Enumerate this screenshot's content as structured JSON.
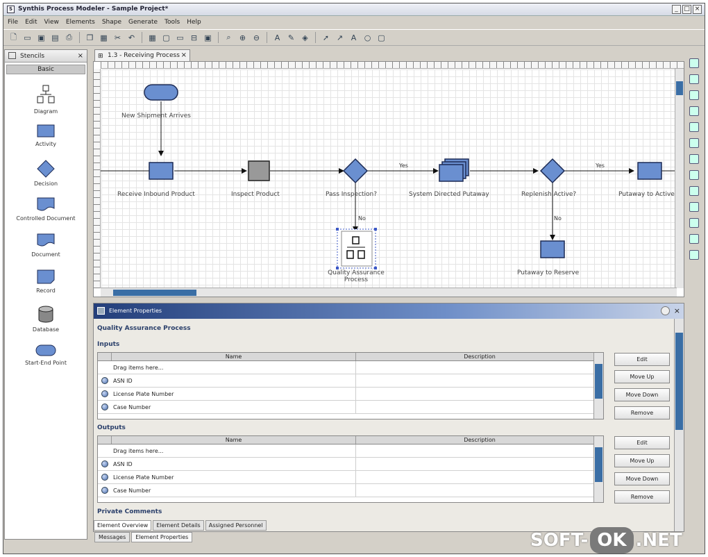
{
  "window": {
    "title": "Synthis Process Modeler - Sample Project*",
    "buttons": [
      "_",
      "□",
      "×"
    ]
  },
  "menu": [
    "File",
    "Edit",
    "View",
    "Elements",
    "Shape",
    "Generate",
    "Tools",
    "Help"
  ],
  "toolbar_icons": [
    "new-icon",
    "open-icon",
    "save-icon",
    "save-all-icon",
    "print-icon",
    "print-preview-icon",
    "copy-icon",
    "paste-icon",
    "cut-icon",
    "undo-icon",
    "grid-icon",
    "layout-icon",
    "align-icon",
    "distribute-icon",
    "page-icon",
    "zoom-fit-icon",
    "zoom-in-icon",
    "zoom-out-icon",
    "text-color-icon",
    "line-color-icon",
    "fill-color-icon",
    "pointer-icon",
    "connector-icon",
    "text-tool-icon",
    "ellipse-tool-icon",
    "rectangle-tool-icon"
  ],
  "stencils": {
    "title": "Stencils",
    "close": "×",
    "group": "Basic",
    "items": [
      "Diagram",
      "Activity",
      "Decision",
      "Controlled Document",
      "Document",
      "Record",
      "Database",
      "Start-End Point"
    ]
  },
  "diagram_tab": {
    "label": "1.3 - Receiving Process",
    "close": "×"
  },
  "diagram": {
    "nodes": {
      "start": "New Shipment Arrives",
      "receive": "Receive Inbound Product",
      "inspect": "Inspect Product",
      "pass": "Pass Inspection?",
      "directed": "System Directed Putaway",
      "replenish": "Replenish Active?",
      "putaway_active": "Putaway to Active",
      "qa": "Quality Assurance Process",
      "putaway_reserve": "Putaway to Reserve"
    },
    "edge_labels": {
      "yes1": "Yes",
      "no1": "No",
      "yes2": "Yes",
      "no2": "No"
    }
  },
  "properties": {
    "panel_title": "Element Properties",
    "element_name": "Quality Assurance Process",
    "inputs_label": "Inputs",
    "outputs_label": "Outputs",
    "columns": [
      "Name",
      "Description"
    ],
    "inputs": [
      "Drag items here...",
      "ASN ID",
      "License Plate Number",
      "Case Number"
    ],
    "outputs": [
      "Drag items here...",
      "ASN ID",
      "License Plate Number",
      "Case Number"
    ],
    "buttons": [
      "Edit",
      "Move Up",
      "Move Down",
      "Remove"
    ],
    "private_comments": "Private Comments",
    "subtabs": [
      "Element Overview",
      "Element Details",
      "Assigned Personnel"
    ]
  },
  "bottom_tabs": [
    "Messages",
    "Element Properties"
  ],
  "watermark": {
    "left": "SOFT-",
    "middle": "OK",
    "right": ".NET"
  },
  "colors": {
    "shape_fill": "#6a8fd0",
    "shape_border": "#1d2b55",
    "selection": "#3b57c6",
    "panel_header": "#233e7a"
  }
}
